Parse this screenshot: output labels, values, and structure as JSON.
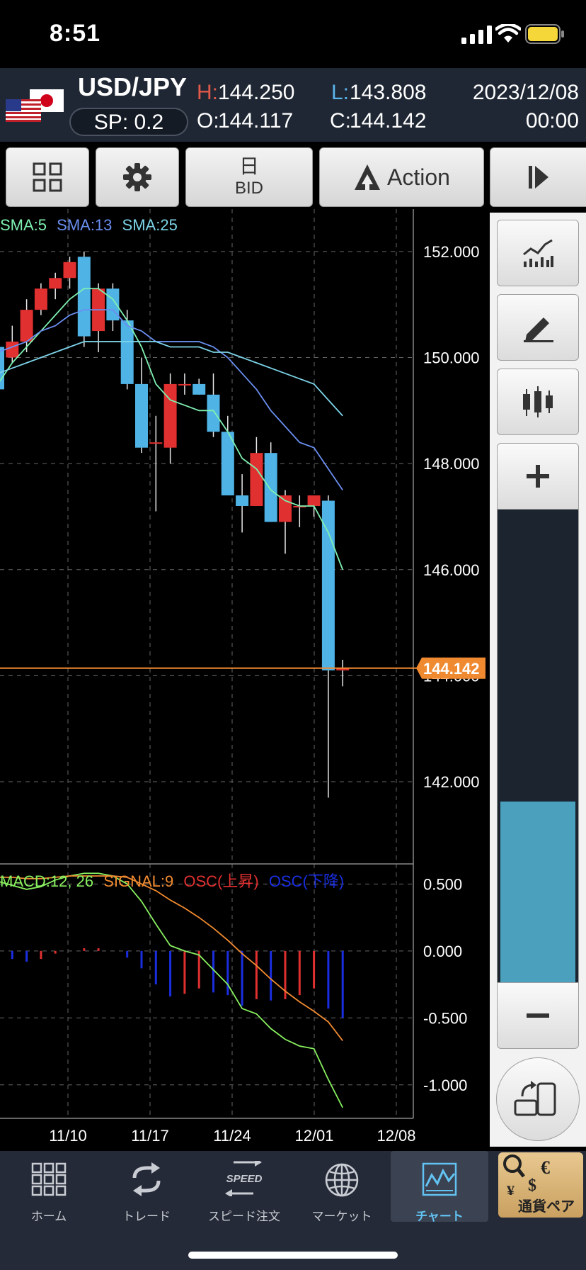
{
  "status_bar": {
    "time": "8:51"
  },
  "quote": {
    "pair": "USD/JPY",
    "spread": "SP: 0.2",
    "high_label": "H:",
    "high": "144.250",
    "low_label": "L:",
    "low": "143.808",
    "open_label": "O:",
    "open": "144.117",
    "close_label": "C:",
    "close": "144.142",
    "date": "2023/12/08",
    "time": "00:00"
  },
  "toolbar": {
    "period": "日",
    "price_type": "BID",
    "action_label": "Action"
  },
  "legend": {
    "sma5": "SMA:5",
    "sma13": "SMA:13",
    "sma25": "SMA:25",
    "macd": "MACD:12, 26",
    "signal": "SIGNAL:9",
    "osc_up": "OSC(上昇)",
    "osc_down": "OSC(下降)"
  },
  "colors": {
    "up": "#e03030",
    "down": "#4fb3e6",
    "sma5": "#7ef0b0",
    "sma13": "#6a8ff0",
    "sma25": "#7cd4e8",
    "macd": "#88f060",
    "signal": "#f08a30",
    "osc_up": "#e03030",
    "osc_down": "#1a2ee0",
    "current_price": "#f08a30"
  },
  "chart_data": [
    {
      "type": "candlestick",
      "title": "USD/JPY daily (BID)",
      "current_price": 144.142,
      "ylim": [
        140.45,
        152.8
      ],
      "y_ticks": [
        "152.000",
        "150.000",
        "148.000",
        "146.000",
        "144.000",
        "142.000"
      ],
      "x_ticks": [
        "11/10",
        "11/17",
        "11/24",
        "12/01",
        "12/08"
      ],
      "candles": [
        {
          "o": 150.2,
          "h": 150.3,
          "l": 149.3,
          "c": 149.4
        },
        {
          "o": 150.0,
          "h": 150.6,
          "l": 149.9,
          "c": 150.3
        },
        {
          "o": 150.3,
          "h": 151.1,
          "l": 150.1,
          "c": 150.9
        },
        {
          "o": 150.9,
          "h": 151.4,
          "l": 150.8,
          "c": 151.3
        },
        {
          "o": 151.3,
          "h": 151.6,
          "l": 151.1,
          "c": 151.5
        },
        {
          "o": 151.5,
          "h": 151.9,
          "l": 151.3,
          "c": 151.8
        },
        {
          "o": 151.9,
          "h": 152.0,
          "l": 150.2,
          "c": 150.4
        },
        {
          "o": 150.5,
          "h": 151.4,
          "l": 150.1,
          "c": 151.3
        },
        {
          "o": 151.3,
          "h": 151.4,
          "l": 150.5,
          "c": 150.7
        },
        {
          "o": 150.7,
          "h": 150.9,
          "l": 149.4,
          "c": 149.5
        },
        {
          "o": 149.5,
          "h": 150.0,
          "l": 148.2,
          "c": 148.3
        },
        {
          "o": 148.4,
          "h": 148.9,
          "l": 147.1,
          "c": 148.4
        },
        {
          "o": 148.3,
          "h": 149.7,
          "l": 148.0,
          "c": 149.5
        },
        {
          "o": 149.5,
          "h": 149.7,
          "l": 149.3,
          "c": 149.5
        },
        {
          "o": 149.5,
          "h": 149.6,
          "l": 149.3,
          "c": 149.3
        },
        {
          "o": 149.3,
          "h": 149.7,
          "l": 148.5,
          "c": 148.6
        },
        {
          "o": 148.6,
          "h": 148.9,
          "l": 147.4,
          "c": 147.4
        },
        {
          "o": 147.4,
          "h": 147.8,
          "l": 146.7,
          "c": 147.2
        },
        {
          "o": 147.2,
          "h": 148.5,
          "l": 147.2,
          "c": 148.2
        },
        {
          "o": 148.2,
          "h": 148.4,
          "l": 146.9,
          "c": 146.9
        },
        {
          "o": 146.9,
          "h": 147.5,
          "l": 146.3,
          "c": 147.4
        },
        {
          "o": 147.2,
          "h": 147.4,
          "l": 146.8,
          "c": 147.2
        },
        {
          "o": 147.2,
          "h": 147.4,
          "l": 147.0,
          "c": 147.4
        },
        {
          "o": 147.3,
          "h": 147.4,
          "l": 141.7,
          "c": 144.1
        },
        {
          "o": 144.1,
          "h": 144.3,
          "l": 143.8,
          "c": 144.142
        }
      ],
      "series": [
        {
          "name": "SMA:5",
          "values": [
            149.5,
            149.9,
            150.2,
            150.5,
            150.8,
            151.1,
            151.3,
            151.3,
            151.1,
            150.7,
            150.2,
            149.5,
            149.2,
            149.1,
            149.0,
            149.0,
            148.6,
            148.1,
            147.9,
            147.5,
            147.3,
            147.2,
            147.2,
            146.7,
            146.0
          ]
        },
        {
          "name": "SMA:13",
          "values": [
            150.1,
            150.2,
            150.3,
            150.5,
            150.6,
            150.8,
            150.9,
            150.9,
            150.9,
            150.6,
            150.5,
            150.3,
            150.3,
            150.3,
            150.3,
            150.2,
            150.0,
            149.7,
            149.4,
            149.0,
            148.7,
            148.4,
            148.3,
            147.9,
            147.5
          ]
        },
        {
          "name": "SMA:25",
          "values": [
            149.7,
            149.8,
            149.9,
            150.0,
            150.1,
            150.2,
            150.3,
            150.3,
            150.3,
            150.3,
            150.3,
            150.3,
            150.2,
            150.2,
            150.2,
            150.1,
            150.1,
            150.0,
            149.9,
            149.8,
            149.7,
            149.6,
            149.5,
            149.2,
            148.9
          ]
        }
      ]
    },
    {
      "type": "macd",
      "ylim": [
        -1.25,
        0.65
      ],
      "y_ticks": [
        "0.500",
        "0.000",
        "-0.500",
        "-1.000"
      ],
      "series": [
        {
          "name": "MACD:12, 26",
          "values": [
            0.52,
            0.49,
            0.46,
            0.48,
            0.53,
            0.56,
            0.58,
            0.58,
            0.56,
            0.5,
            0.37,
            0.2,
            0.04,
            0.0,
            -0.03,
            -0.14,
            -0.25,
            -0.43,
            -0.47,
            -0.58,
            -0.66,
            -0.71,
            -0.73,
            -0.96,
            -1.17
          ]
        },
        {
          "name": "SIGNAL:9",
          "values": [
            0.55,
            0.55,
            0.54,
            0.54,
            0.55,
            0.56,
            0.56,
            0.56,
            0.56,
            0.55,
            0.5,
            0.45,
            0.38,
            0.32,
            0.25,
            0.17,
            0.08,
            -0.02,
            -0.11,
            -0.21,
            -0.3,
            -0.38,
            -0.45,
            -0.53,
            -0.67
          ]
        },
        {
          "name": "OSC",
          "values": [
            -0.03,
            -0.06,
            -0.08,
            -0.06,
            -0.02,
            0.0,
            0.02,
            0.02,
            0.0,
            -0.05,
            -0.13,
            -0.25,
            -0.34,
            -0.32,
            -0.28,
            -0.31,
            -0.33,
            -0.41,
            -0.36,
            -0.37,
            -0.36,
            -0.33,
            -0.28,
            -0.43,
            -0.5
          ]
        }
      ]
    }
  ],
  "nav": {
    "home": "ホーム",
    "trade": "トレード",
    "speed": "スピード注文",
    "speed_badge": "SPEED",
    "market": "マーケット",
    "chart": "チャート",
    "pairs": "通貨ペア"
  }
}
